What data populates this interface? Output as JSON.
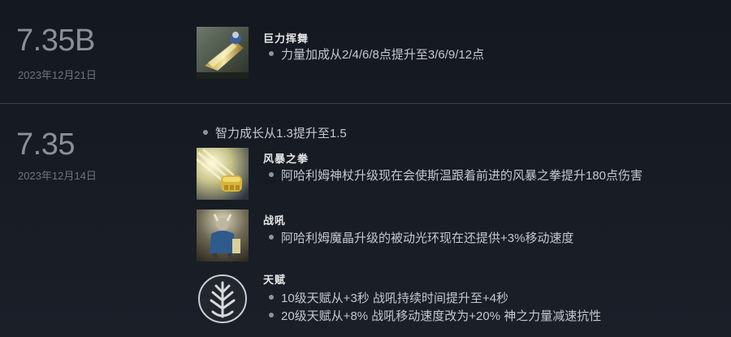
{
  "patches": [
    {
      "version": "7.35B",
      "date": "2023年12月21日",
      "entries": [
        {
          "icon": "enchanted-axe-icon",
          "title": "巨力挥舞",
          "bullets": [
            "力量加成从2/4/6/8点提升至3/6/9/12点"
          ]
        }
      ]
    },
    {
      "version": "7.35",
      "date": "2023年12月14日",
      "general_bullet": "智力成长从1.3提升至1.5",
      "entries": [
        {
          "icon": "storm-fist-icon",
          "title": "风暴之拳",
          "bullets": [
            "阿哈利姆神杖升级现在会使斯温跟着前进的风暴之拳提升180点伤害"
          ]
        },
        {
          "icon": "warcry-icon",
          "title": "战吼",
          "bullets": [
            "阿哈利姆魔晶升级的被动光环现在还提供+3%移动速度"
          ]
        },
        {
          "icon": "talent-tree-icon",
          "title": "天赋",
          "bullets": [
            "10级天赋从+3秒 战吼持续时间提升至+4秒",
            "20级天赋从+8% 战吼移动速度改为+20% 神之力量减速抗性"
          ]
        }
      ]
    }
  ]
}
